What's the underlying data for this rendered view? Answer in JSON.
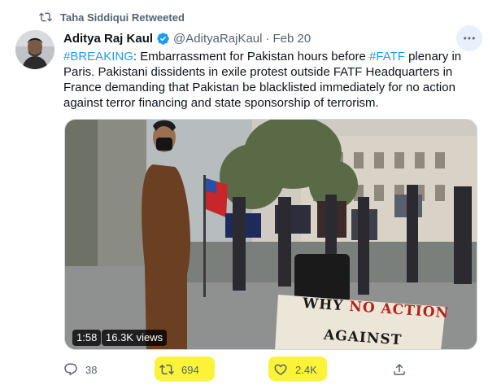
{
  "retweet_context": {
    "text": "Taha Siddiqui Retweeted",
    "icon": "retweet-icon"
  },
  "tweet": {
    "author_name": "Aditya Raj Kaul",
    "verified": true,
    "handle": "@AdityaRajKaul",
    "separator": "·",
    "date": "Feb 20",
    "text_parts": {
      "hashtag1": "#BREAKING",
      "part1": ": Embarrassment for Pakistan hours before ",
      "hashtag2": "#FATF",
      "part2": " plenary in Paris. Pakistani dissidents in exile protest outside FATF Headquarters in France demanding that Pakistan be blacklisted immediately for no action against terror financing and state sponsorship of terrorism."
    }
  },
  "media": {
    "duration": "1:58",
    "views": "16.3K views",
    "sign_text_line1_black": "WHY ",
    "sign_text_line1_red": "NO ACTION",
    "sign_text_line2": "AGAINST"
  },
  "actions": {
    "reply_count": "38",
    "retweet_count": "694",
    "like_count": "2.4K"
  },
  "colors": {
    "link": "#1d9bf0",
    "secondary_text": "#536471",
    "highlight": "#fbf337",
    "verified": "#1d9bf0"
  }
}
